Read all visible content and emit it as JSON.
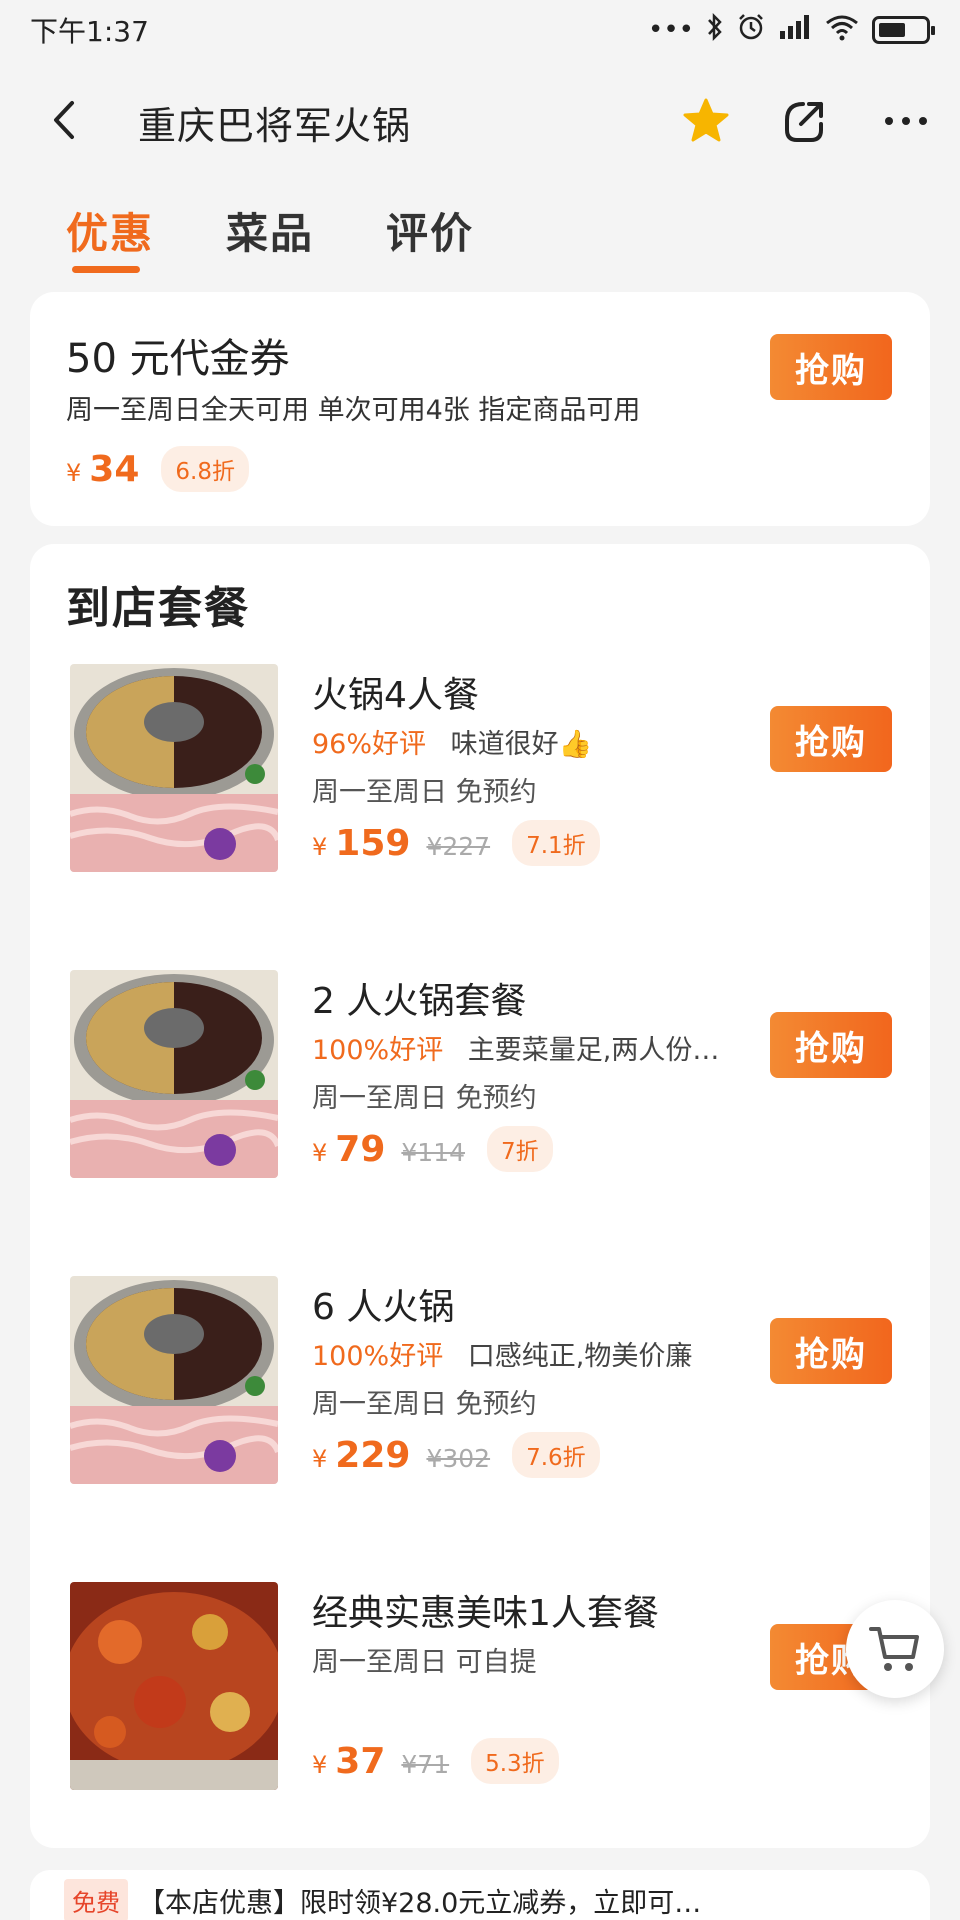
{
  "status_bar": {
    "time": "下午1:37"
  },
  "header": {
    "title": "重庆巴将军火锅"
  },
  "tabs": [
    {
      "label": "优惠"
    },
    {
      "label": "菜品"
    },
    {
      "label": "评价"
    }
  ],
  "voucher": {
    "title": "50 元代金券",
    "desc": "周一至周日全天可用  单次可用4张  指定商品可用",
    "currency": "¥",
    "price": "34",
    "discount": "6.8折",
    "buy_label": "抢购"
  },
  "packages": {
    "title": "到店套餐",
    "items": [
      {
        "name": "火锅4人餐",
        "rating": "96%好评",
        "comment": "味道很好👍",
        "days": "周一至周日  免预约",
        "currency": "¥",
        "price": "159",
        "original": "¥227",
        "discount": "7.1折",
        "buy_label": "抢购"
      },
      {
        "name": "2 人火锅套餐",
        "rating": "100%好评",
        "comment": "主要菜量足,两人份…",
        "days": "周一至周日  免预约",
        "currency": "¥",
        "price": "79",
        "original": "¥114",
        "discount": "7折",
        "buy_label": "抢购"
      },
      {
        "name": "6 人火锅",
        "rating": "100%好评",
        "comment": "口感纯正,物美价廉",
        "days": "周一至周日  免预约",
        "currency": "¥",
        "price": "229",
        "original": "¥302",
        "discount": "7.6折",
        "buy_label": "抢购"
      },
      {
        "name": "经典实惠美味1人套餐",
        "rating": "",
        "comment": "",
        "days": "周一至周日  可自提",
        "currency": "¥",
        "price": "37",
        "original": "¥71",
        "discount": "5.3折",
        "buy_label": "抢购"
      }
    ]
  },
  "promo": {
    "tag": "免费",
    "text": "【本店优惠】限时领¥28.0元立减券，立即可…"
  },
  "colors": {
    "accent": "#f06a1d",
    "star": "#f7b500"
  },
  "icons": [
    "back-arrow-icon",
    "star-icon",
    "share-icon",
    "more-icon",
    "cart-icon"
  ]
}
